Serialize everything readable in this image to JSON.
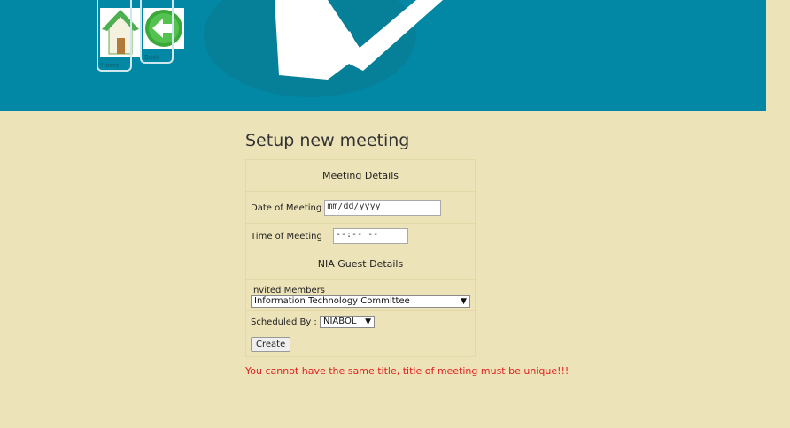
{
  "nav": {
    "home_label": "Home",
    "back_label": "Back"
  },
  "page": {
    "title": "Setup new meeting"
  },
  "form": {
    "meeting_details_heading": "Meeting Details",
    "date_label": "Date of Meeting",
    "date_placeholder": "mm/dd/yyyy",
    "time_label": "Time of Meeting",
    "time_placeholder": "--:-- --",
    "guest_heading": "NIA Guest Details",
    "invited_label": "Invited Members",
    "invited_selected": "Information Technology Committee",
    "scheduled_label": "Scheduled By :",
    "scheduled_selected": "NIABOL",
    "create_label": "Create"
  },
  "error_message": "You cannot have the same title, title of meeting must be unique!!!",
  "colors": {
    "banner": "#0288a4",
    "background": "#ede3b9",
    "error": "#e42020"
  }
}
